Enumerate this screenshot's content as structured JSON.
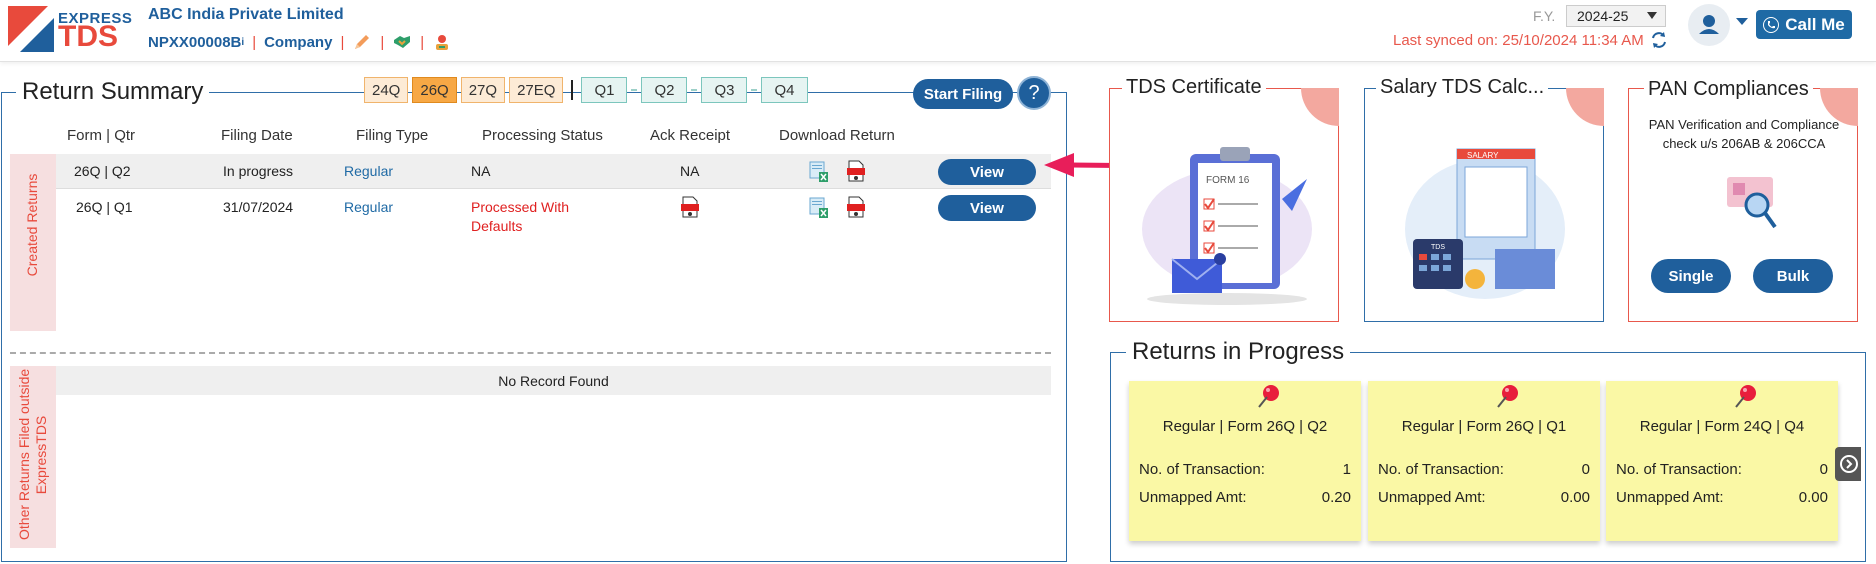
{
  "header": {
    "logo_top": "EXPRESS",
    "logo_main": "TDS",
    "company_name": "ABC India Private Limited",
    "tan": "NPXX00008B",
    "info_mark": "i",
    "sep": "|",
    "entity_type": "Company",
    "fy_label": "F.Y.",
    "fy_value": "2024-25",
    "last_synced": "Last synced on: 25/10/2024 11:34 AM",
    "call_me": "Call Me"
  },
  "return_summary": {
    "title": "Return Summary",
    "form_chips": [
      "24Q",
      "26Q",
      "27Q",
      "27EQ"
    ],
    "active_form": "26Q",
    "quarter_chips": [
      "Q1",
      "Q2",
      "Q3",
      "Q4"
    ],
    "start_filing": "Start Filing",
    "help": "?",
    "columns": [
      "Form | Qtr",
      "Filing Date",
      "Filing Type",
      "Processing Status",
      "Ack Receipt",
      "Download Return"
    ],
    "created_label": "Created Returns",
    "rows": [
      {
        "form_qtr": "26Q | Q2",
        "filing_date": "In progress",
        "filing_type": "Regular",
        "status": "NA",
        "ack": "NA",
        "view": "View"
      },
      {
        "form_qtr": "26Q | Q1",
        "filing_date": "31/07/2024",
        "filing_type": "Regular",
        "status_line1": "Processed With",
        "status_line2": "Defaults",
        "view": "View"
      }
    ],
    "other_label_line1": "Other Returns Filed outside",
    "other_label_line2": "ExpressTDS",
    "no_record": "No Record Found"
  },
  "cards": {
    "tds_certificate": {
      "title": "TDS Certificate",
      "form_label": "FORM 16"
    },
    "salary_calc": {
      "title": "Salary TDS Calc...",
      "salary_label": "SALARY",
      "tds_label": "TDS"
    },
    "pan": {
      "title": "PAN Compliances",
      "desc_line1": "PAN Verification and Compliance",
      "desc_line2": "check u/s 206AB & 206CCA",
      "single": "Single",
      "bulk": "Bulk"
    }
  },
  "returns_in_progress": {
    "title": "Returns in Progress",
    "items": [
      {
        "title": "Regular | Form 26Q | Q2",
        "txn_label": "No. of Transaction:",
        "txn": "1",
        "amt_label": "Unmapped Amt:",
        "amt": "0.20"
      },
      {
        "title": "Regular | Form 26Q | Q1",
        "txn_label": "No. of Transaction:",
        "txn": "0",
        "amt_label": "Unmapped Amt:",
        "amt": "0.00"
      },
      {
        "title": "Regular | Form 24Q | Q4",
        "txn_label": "No. of Transaction:",
        "txn": "0",
        "amt_label": "Unmapped Amt:",
        "amt": "0.00"
      }
    ]
  },
  "colors": {
    "primary": "#1f5f9c",
    "accent": "#e84a3c",
    "note": "#faf8a5"
  }
}
